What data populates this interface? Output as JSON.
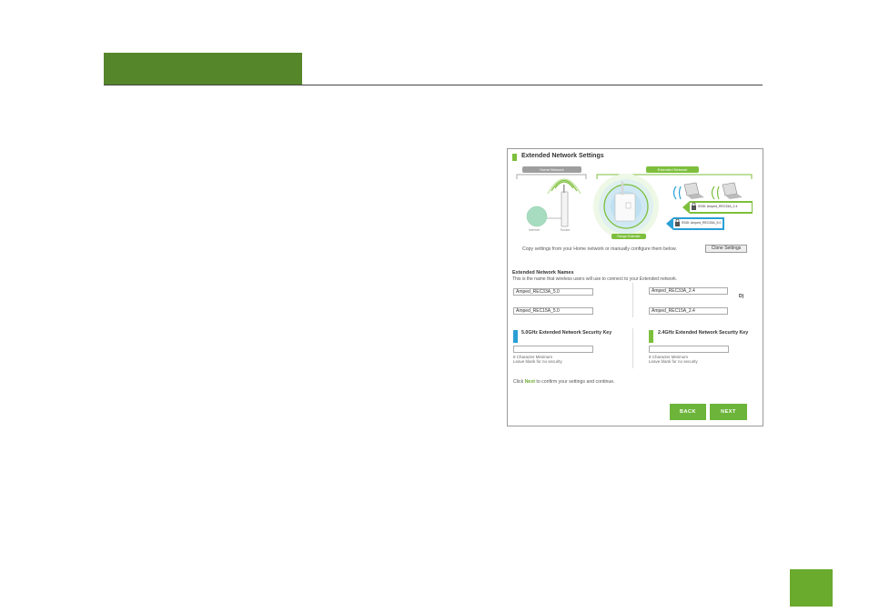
{
  "panel": {
    "title": "Extended Network Settings",
    "diagram": {
      "home_network_label": "Home Network",
      "extended_network_label": "Extended Network",
      "internet_label": "Internet",
      "router_label": "Router",
      "range_extender_label": "Range Extender",
      "ssid_24_label": "SSID: Amped_REC33A_2.4",
      "ssid_5_label": "SSID: Amped_REC33A_5.0"
    },
    "copy_text": "Copy settings from your Home network or manually configure them below.",
    "clone_button": "Clone Settings",
    "names_section": {
      "title": "Extended Network Names",
      "description": "This is the name that wireless users will use to connect to your Extended network.",
      "field_5g_row1": "Amped_REC33A_5.0",
      "field_24g_row1": "Amped_REC33A_2.4",
      "field_5g_row2": "Amped_REC15A_5.0",
      "field_24g_row2": "Amped_REC15A_2.4",
      "truncated_text": "D)"
    },
    "key_5g": {
      "title": "5.0GHz Extended Network Security Key",
      "value": "",
      "note1": "8 Character Minimum",
      "note2": "Leave blank for no security"
    },
    "key_24g": {
      "title": "2.4GHz Extended Network Security Key",
      "value": "",
      "note1": "8 Character Minimum",
      "note2": "Leave blank for no security"
    },
    "click_text_pre": "Click ",
    "click_text_next": "Next",
    "click_text_post": " to confirm your settings and continue.",
    "back_button": "BACK",
    "next_button": "NEXT"
  },
  "colors": {
    "header_green": "#55862a",
    "page_box_green": "#6aaa2d",
    "accent_green": "#7dbf3c",
    "accent_blue": "#2a9fd6"
  }
}
